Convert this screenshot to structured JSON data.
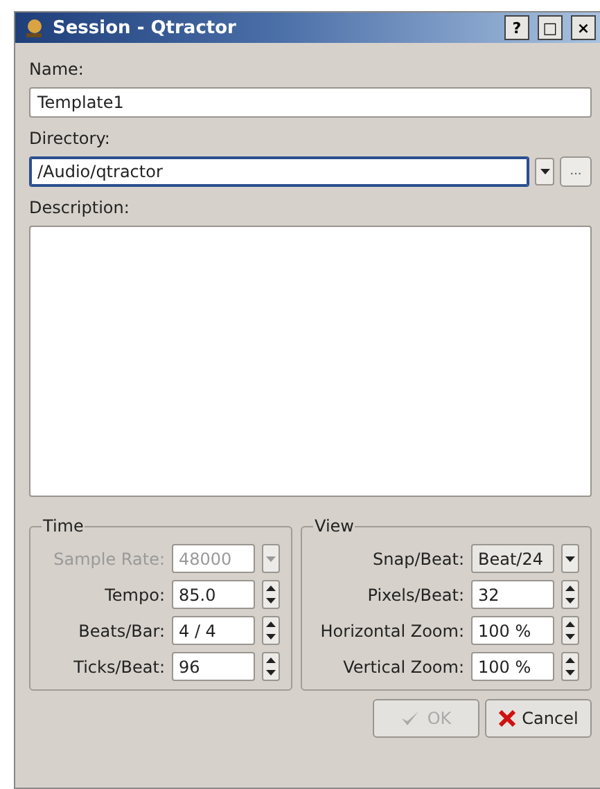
{
  "window": {
    "title": "Session - Qtractor",
    "buttons": [
      "?",
      "□",
      "×"
    ]
  },
  "name": {
    "label": "Name:",
    "value": "Template1"
  },
  "directory": {
    "label": "Directory:",
    "value": "/Audio/qtractor",
    "focused": true,
    "browse": "..."
  },
  "description": {
    "label": "Description:"
  },
  "time": {
    "title": "Time",
    "fields": [
      {
        "kind": "combo",
        "label": "Sample Rate:",
        "value": "48000",
        "disabled": true
      },
      {
        "kind": "spin",
        "label": "Tempo:",
        "value": "85.0",
        "disabled": false
      },
      {
        "kind": "spin",
        "label": "Beats/Bar:",
        "value": "4 / 4",
        "disabled": false
      },
      {
        "kind": "spin",
        "label": "Ticks/Beat:",
        "value": "96",
        "disabled": false
      }
    ]
  },
  "view": {
    "title": "View",
    "fields": [
      {
        "kind": "button-combo",
        "label": "Snap/Beat:",
        "value": "Beat/24",
        "disabled": false
      },
      {
        "kind": "spin",
        "label": "Pixels/Beat:",
        "value": "32",
        "disabled": false
      },
      {
        "kind": "spin",
        "label": "Horizontal Zoom:",
        "value": "100 %",
        "disabled": false
      },
      {
        "kind": "spin",
        "label": "Vertical Zoom:",
        "value": "100 %",
        "disabled": false
      }
    ]
  },
  "actions": [
    {
      "kind": "ok",
      "label": "OK",
      "disabled": true
    },
    {
      "kind": "cancel",
      "label": "Cancel",
      "disabled": false
    }
  ]
}
